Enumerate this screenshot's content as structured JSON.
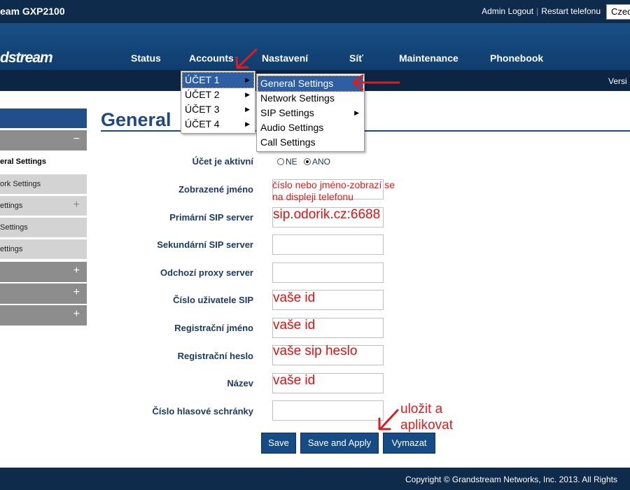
{
  "topbar": {
    "model": "eam GXP2100",
    "admin_logout": "Admin Logout",
    "separator": "|",
    "restart": "Restart telefonu",
    "language": "Czec"
  },
  "header": {
    "brand": "dstream",
    "nav": [
      "Status",
      "Accounts",
      "Nastavení",
      "Síť",
      "Maintenance",
      "Phonebook"
    ]
  },
  "subbar": {
    "version": "Versi"
  },
  "sidebar": {
    "groups": [
      {
        "label": "",
        "sign": "−"
      },
      {
        "label": "",
        "sign": "+"
      },
      {
        "label": "",
        "sign": "+"
      },
      {
        "label": "",
        "sign": "+"
      }
    ],
    "items": [
      {
        "label": "eral Settings"
      },
      {
        "label": "ork Settings"
      },
      {
        "label": "ettings",
        "sign": "+"
      },
      {
        "label": "Settings"
      },
      {
        "label": "ettings"
      }
    ]
  },
  "page": {
    "title": "General"
  },
  "accounts_menu": {
    "items": [
      {
        "label": "ÚČET 1",
        "arrow": "▶"
      },
      {
        "label": "ÚČET 2",
        "arrow": "▶"
      },
      {
        "label": "ÚČET 3",
        "arrow": "▶"
      },
      {
        "label": "ÚČET 4",
        "arrow": "▶"
      }
    ]
  },
  "account_submenu": {
    "items": [
      {
        "label": "General Settings"
      },
      {
        "label": "Network Settings"
      },
      {
        "label": "SIP Settings",
        "arrow": "▶"
      },
      {
        "label": "Audio Settings"
      },
      {
        "label": "Call Settings"
      }
    ]
  },
  "form": {
    "active_label": "Účet je aktivní",
    "radio_no": "NE",
    "radio_yes": "ANO",
    "radio_selected": "ANO",
    "display_name_label": "Zobrazené jméno",
    "display_name_note_1": "číslo nebo jméno-zobrazí se",
    "display_name_note_2": "na displeji telefonu",
    "primary_sip_label": "Primární SIP server",
    "primary_sip_value": "sip.odorik.cz:6688",
    "secondary_sip_label": "Sekundární SIP server",
    "outbound_proxy_label": "Odchozí proxy server",
    "sip_user_label": "Číslo uživatele SIP",
    "sip_user_value": "vaše id",
    "auth_name_label": "Registrační jméno",
    "auth_name_value": "vaše id",
    "auth_password_label": "Registrační heslo",
    "auth_password_value": "vaše sip heslo",
    "name_label": "Název",
    "name_value": "vaše id",
    "voicemail_label": "Číslo hlasové schránky"
  },
  "buttons": {
    "save": "Save",
    "save_apply": "Save and Apply",
    "clear": "Vymazat"
  },
  "annotation": {
    "line1": "uložit a",
    "line2": "aplikovat"
  },
  "footer": {
    "copyright": "Copyright © Grandstream Networks, Inc. 2013. All Rights"
  },
  "colors": {
    "accent": "#1e4a80",
    "annotation": "#d81e1e",
    "button": "#164c86"
  }
}
